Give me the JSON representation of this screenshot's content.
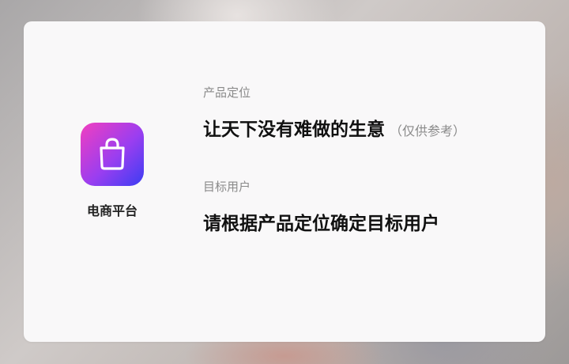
{
  "app": {
    "name": "电商平台",
    "icon": "shopping-bag-icon",
    "icon_gradient": [
      "#f23fbf",
      "#9a3ef0",
      "#3b3df3"
    ]
  },
  "positioning": {
    "label": "产品定位",
    "value": "让天下没有难做的生意",
    "note": "（仅供参考）"
  },
  "target_users": {
    "label": "目标用户",
    "value": "请根据产品定位确定目标用户"
  },
  "colors": {
    "card_background": "#f9f8f9",
    "label_text": "#8a8a8a",
    "value_text": "#111111"
  }
}
